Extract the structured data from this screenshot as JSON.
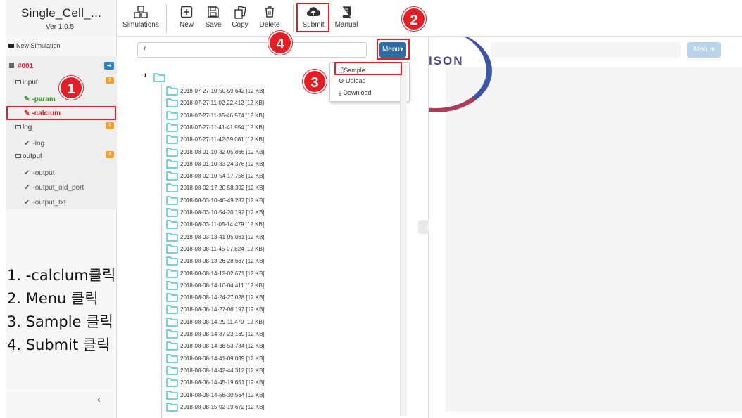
{
  "app": {
    "title": "Single_Cell_...",
    "version": "Ver 1.0.5"
  },
  "toolbar": {
    "simulations": "Simulations",
    "new": "New",
    "save": "Save",
    "copy": "Copy",
    "delete": "Delete",
    "submit": "Submit",
    "manual": "Manual"
  },
  "sidebar": {
    "new_simulation": "New Simulation",
    "job": "#001",
    "input_label": "input",
    "input_count": "2",
    "param": "-param",
    "calcium": "-calcium",
    "log_label": "log",
    "log_count": "1",
    "log_item": "-log",
    "output_label": "output",
    "output_count": "3",
    "outputs": [
      "-output",
      "-output_old_port",
      "-output_txt"
    ]
  },
  "file_panel": {
    "path": "/",
    "menu_label": "Menu▾",
    "dropdown": {
      "sample": "Sample",
      "upload": "Upload",
      "download": "Download"
    },
    "files": [
      "2018-07-27-10-50-59.642 [12 KB]",
      "2018-07-27-11-02-22.412 [12 KB]",
      "2018-07-27-11-35-46.974 [12 KB]",
      "2018-07-27-11-41-41.954 [12 KB]",
      "2018-07-27-11-42-39.081 [12 KB]",
      "2018-08-01-10-32-05.866 [12 KB]",
      "2018-08-01-10-33-24.376 [12 KB]",
      "2018-08-02-10-54-17.758 [12 KB]",
      "2018-08-02-17-20-58.302 [12 KB]",
      "2018-08-03-10-48-49.287 [12 KB]",
      "2018-08-03-10-54-20.192 [12 KB]",
      "2018-08-03-11-05-14.479 [12 KB]",
      "2018-08-03-13-41-05.061 [12 KB]",
      "2018-08-08-11-45-07.824 [12 KB]",
      "2018-08-08-13-26-28.667 [12 KB]",
      "2018-08-08-14-12-02.671 [12 KB]",
      "2018-08-08-14-16-04.411 [12 KB]",
      "2018-08-08-14-24-27.028 [12 KB]",
      "2018-08-08-14-27-06.197 [12 KB]",
      "2018-08-08-14-29-11.479 [12 KB]",
      "2018-08-08-14-37-23.169 [12 KB]",
      "2018-08-08-14-38-53.784 [12 KB]",
      "2018-08-08-14-41-09.039 [12 KB]",
      "2018-08-08-14-42-44.312 [12 KB]",
      "2018-08-08-14-45-19.651 [12 KB]",
      "2018-08-08-14-58-30.564 [12 KB]",
      "2018-08-08-15-02-19.672 [12 KB]"
    ]
  },
  "right_panel": {
    "menu_label": "Menu▾",
    "logo_text": "ISON"
  },
  "instructions": [
    "1. -calclum클릭",
    "2. Menu 클릭",
    "3. Sample 클릭",
    "4. Submit 클릭"
  ],
  "steps": [
    "1",
    "2",
    "3",
    "4"
  ],
  "colors": {
    "accent": "#2d6da3",
    "annotation": "#e31e25",
    "badge": "#f0a030",
    "folder": "#2bb3c6",
    "active_red": "#e0202a",
    "param_green": "#3a9a2a"
  }
}
